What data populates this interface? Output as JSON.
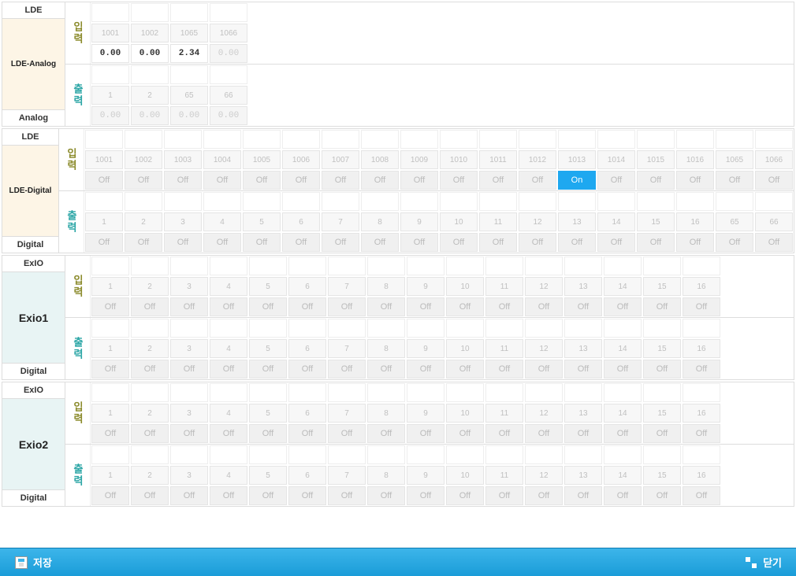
{
  "sections": [
    {
      "id": "lde-analog",
      "header": "LDE",
      "body": "LDE-Analog",
      "footer": "Analog",
      "tint": "warm",
      "input": {
        "label": "입력",
        "headers": [
          "1001",
          "1002",
          "1065",
          "1066"
        ],
        "values": [
          {
            "v": "0.00",
            "enabled": true
          },
          {
            "v": "0.00",
            "enabled": true
          },
          {
            "v": "2.34",
            "enabled": true
          },
          {
            "v": "0.00",
            "enabled": false
          }
        ]
      },
      "output": {
        "label": "출력",
        "headers": [
          "1",
          "2",
          "65",
          "66"
        ],
        "values": [
          {
            "v": "0.00",
            "enabled": false
          },
          {
            "v": "0.00",
            "enabled": false
          },
          {
            "v": "0.00",
            "enabled": false
          },
          {
            "v": "0.00",
            "enabled": false
          }
        ]
      }
    },
    {
      "id": "lde-digital",
      "header": "LDE",
      "body": "LDE-Digital",
      "footer": "Digital",
      "tint": "warm",
      "input": {
        "label": "입력",
        "headers": [
          "1001",
          "1002",
          "1003",
          "1004",
          "1005",
          "1006",
          "1007",
          "1008",
          "1009",
          "1010",
          "1011",
          "1012",
          "1013",
          "1014",
          "1015",
          "1016",
          "1065",
          "1066"
        ],
        "states": [
          "Off",
          "Off",
          "Off",
          "Off",
          "Off",
          "Off",
          "Off",
          "Off",
          "Off",
          "Off",
          "Off",
          "Off",
          "On",
          "Off",
          "Off",
          "Off",
          "Off",
          "Off"
        ]
      },
      "output": {
        "label": "출력",
        "headers": [
          "1",
          "2",
          "3",
          "4",
          "5",
          "6",
          "7",
          "8",
          "9",
          "10",
          "11",
          "12",
          "13",
          "14",
          "15",
          "16",
          "65",
          "66"
        ],
        "states": [
          "Off",
          "Off",
          "Off",
          "Off",
          "Off",
          "Off",
          "Off",
          "Off",
          "Off",
          "Off",
          "Off",
          "Off",
          "Off",
          "Off",
          "Off",
          "Off",
          "Off",
          "Off"
        ]
      }
    },
    {
      "id": "exio1",
      "header": "ExIO",
      "body": "Exio1",
      "footer": "Digital",
      "tint": "cool",
      "input": {
        "label": "입력",
        "headers": [
          "1",
          "2",
          "3",
          "4",
          "5",
          "6",
          "7",
          "8",
          "9",
          "10",
          "11",
          "12",
          "13",
          "14",
          "15",
          "16"
        ],
        "states": [
          "Off",
          "Off",
          "Off",
          "Off",
          "Off",
          "Off",
          "Off",
          "Off",
          "Off",
          "Off",
          "Off",
          "Off",
          "Off",
          "Off",
          "Off",
          "Off"
        ]
      },
      "output": {
        "label": "출력",
        "headers": [
          "1",
          "2",
          "3",
          "4",
          "5",
          "6",
          "7",
          "8",
          "9",
          "10",
          "11",
          "12",
          "13",
          "14",
          "15",
          "16"
        ],
        "states": [
          "Off",
          "Off",
          "Off",
          "Off",
          "Off",
          "Off",
          "Off",
          "Off",
          "Off",
          "Off",
          "Off",
          "Off",
          "Off",
          "Off",
          "Off",
          "Off"
        ]
      }
    },
    {
      "id": "exio2",
      "header": "ExIO",
      "body": "Exio2",
      "footer": "Digital",
      "tint": "cool",
      "input": {
        "label": "입력",
        "headers": [
          "1",
          "2",
          "3",
          "4",
          "5",
          "6",
          "7",
          "8",
          "9",
          "10",
          "11",
          "12",
          "13",
          "14",
          "15",
          "16"
        ],
        "states": [
          "Off",
          "Off",
          "Off",
          "Off",
          "Off",
          "Off",
          "Off",
          "Off",
          "Off",
          "Off",
          "Off",
          "Off",
          "Off",
          "Off",
          "Off",
          "Off"
        ]
      },
      "output": {
        "label": "출력",
        "headers": [
          "1",
          "2",
          "3",
          "4",
          "5",
          "6",
          "7",
          "8",
          "9",
          "10",
          "11",
          "12",
          "13",
          "14",
          "15",
          "16"
        ],
        "states": [
          "Off",
          "Off",
          "Off",
          "Off",
          "Off",
          "Off",
          "Off",
          "Off",
          "Off",
          "Off",
          "Off",
          "Off",
          "Off",
          "Off",
          "Off",
          "Off"
        ]
      }
    }
  ],
  "footer": {
    "save": "저장",
    "close": "닫기"
  }
}
